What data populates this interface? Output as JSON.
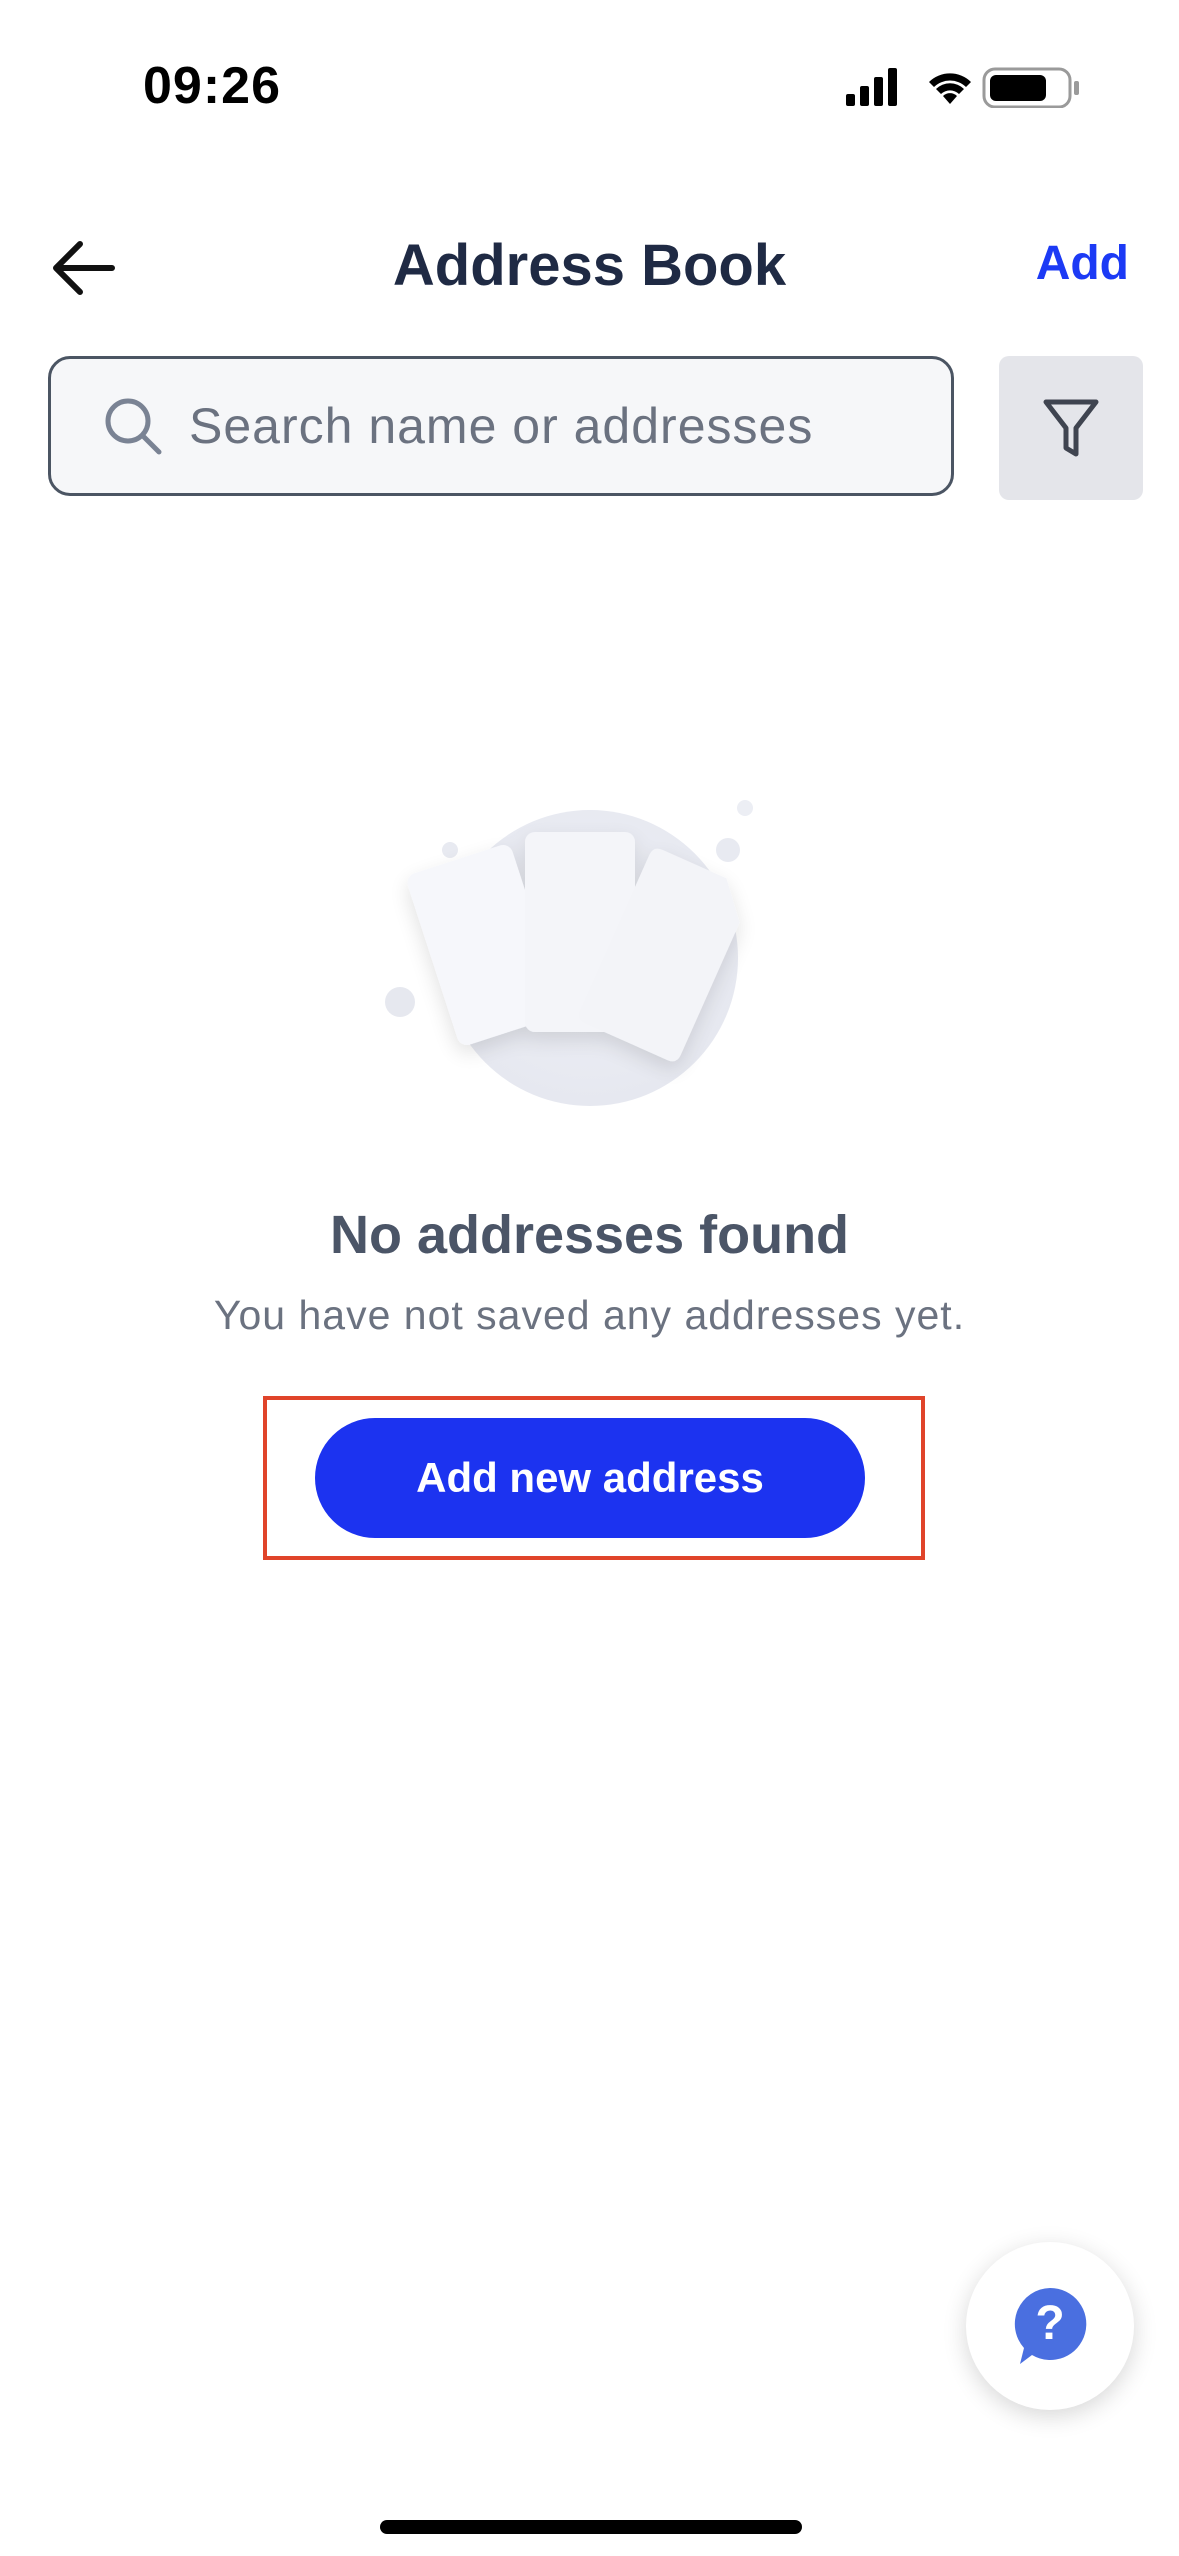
{
  "status_bar": {
    "time": "09:26",
    "icons": [
      "signal-icon",
      "wifi-icon",
      "battery-icon"
    ]
  },
  "header": {
    "title": "Address Book",
    "add_label": "Add",
    "back_icon": "arrow-left-icon"
  },
  "search": {
    "placeholder": "Search name or addresses",
    "value": "",
    "icon": "search-icon"
  },
  "filter": {
    "icon": "filter-icon"
  },
  "empty_state": {
    "illustration": "empty-documents-illustration",
    "title": "No addresses found",
    "subtitle": "You have not saved any addresses yet.",
    "button_label": "Add new address"
  },
  "help": {
    "icon": "help-icon"
  },
  "colors": {
    "accent": "#1c33f0",
    "title_text": "#1f2a44",
    "muted_text": "#6b7280",
    "highlight_border": "#e0442a",
    "help_icon": "#4a6fe0"
  }
}
